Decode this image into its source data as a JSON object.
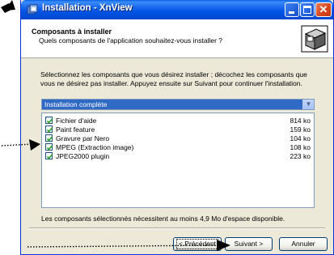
{
  "window": {
    "title": "Installation - XnView"
  },
  "header": {
    "title": "Composants à installer",
    "subtitle": "Quels composants de l'application souhaitez-vous installer ?"
  },
  "instructions": "Sélectionnez les composants que vous désirez installer ; décochez les composants que vous ne désirez pas installer. Appuyez ensuite sur Suivant pour continuer l'installation.",
  "combo": {
    "selected": "Installation complète"
  },
  "components": [
    {
      "label": "Fichier d'aide",
      "size": "814 ko",
      "checked": true
    },
    {
      "label": "Paint feature",
      "size": "159 ko",
      "checked": true
    },
    {
      "label": "Gravure par Nero",
      "size": "104 ko",
      "checked": true
    },
    {
      "label": "MPEG (Extraction image)",
      "size": "108 ko",
      "checked": true
    },
    {
      "label": "JPEG2000 plugin",
      "size": "223 ko",
      "checked": true
    }
  ],
  "space_note": "Les composants sélectionnés nécessitent au moins 4,9 Mo d'espace disponible.",
  "buttons": {
    "prev": "< Précédent",
    "next": "Suivant >",
    "cancel": "Annuler"
  },
  "icons": {
    "title": "installer-icon",
    "header": "computer-box-icon",
    "close": "close-icon"
  },
  "colors": {
    "titlebar": "#0054e3",
    "selection": "#316ac5",
    "window_bg": "#ece9d8"
  }
}
